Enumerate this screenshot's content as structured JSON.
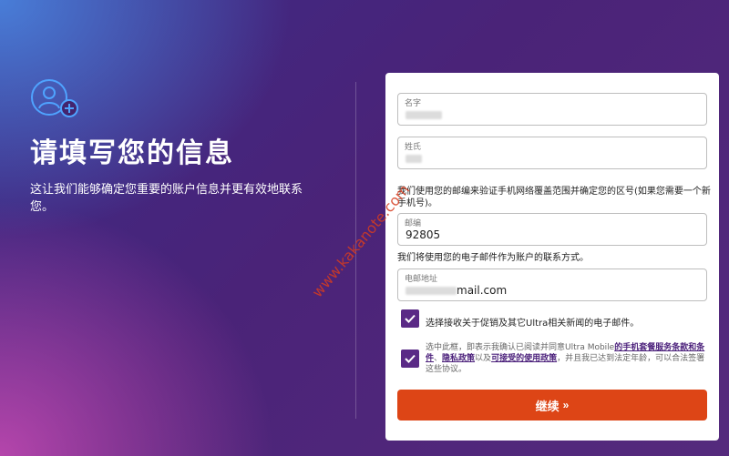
{
  "left_panel": {
    "title": "请填写您的信息",
    "subtitle": "这让我们能够确定您重要的账户信息并更有效地联系您。"
  },
  "form": {
    "first_name": {
      "label": "名字",
      "value": ""
    },
    "last_name": {
      "label": "姓氏",
      "value": ""
    },
    "zip_note": "我们使用您的邮编来验证手机网络覆盖范围并确定您的区号(如果您需要一个新手机号)。",
    "zip": {
      "label": "邮编",
      "value": "92805"
    },
    "email_note": "我们将使用您的电子邮件作为账户的联系方式。",
    "email": {
      "label": "电邮地址",
      "value_suffix": "mail.com"
    },
    "promo_checkbox": {
      "label": "选择接收关于促销及其它Ultra相关新闻的电子邮件。",
      "checked": true
    },
    "terms_checkbox": {
      "checked": true,
      "text_1": "选中此框，即表示我确认已阅读并同意Ultra Mobile",
      "link_1": "的手机套餐服务条款和条件",
      "text_2": "、",
      "link_2": "隐私政策",
      "text_3": "以及",
      "link_3": "可接受的使用政策",
      "text_4": "，并且我已达到法定年龄，可以合法签署这些协议。"
    },
    "continue_button": {
      "label": "继续",
      "chevron": "»"
    }
  },
  "watermark": "www.kakanote.com",
  "icons": {
    "user_add": "user-add-icon",
    "check": "check-icon"
  },
  "colors": {
    "accent": "#dd4516",
    "checkbox": "#5a2a86",
    "link": "#4a1f7a"
  }
}
